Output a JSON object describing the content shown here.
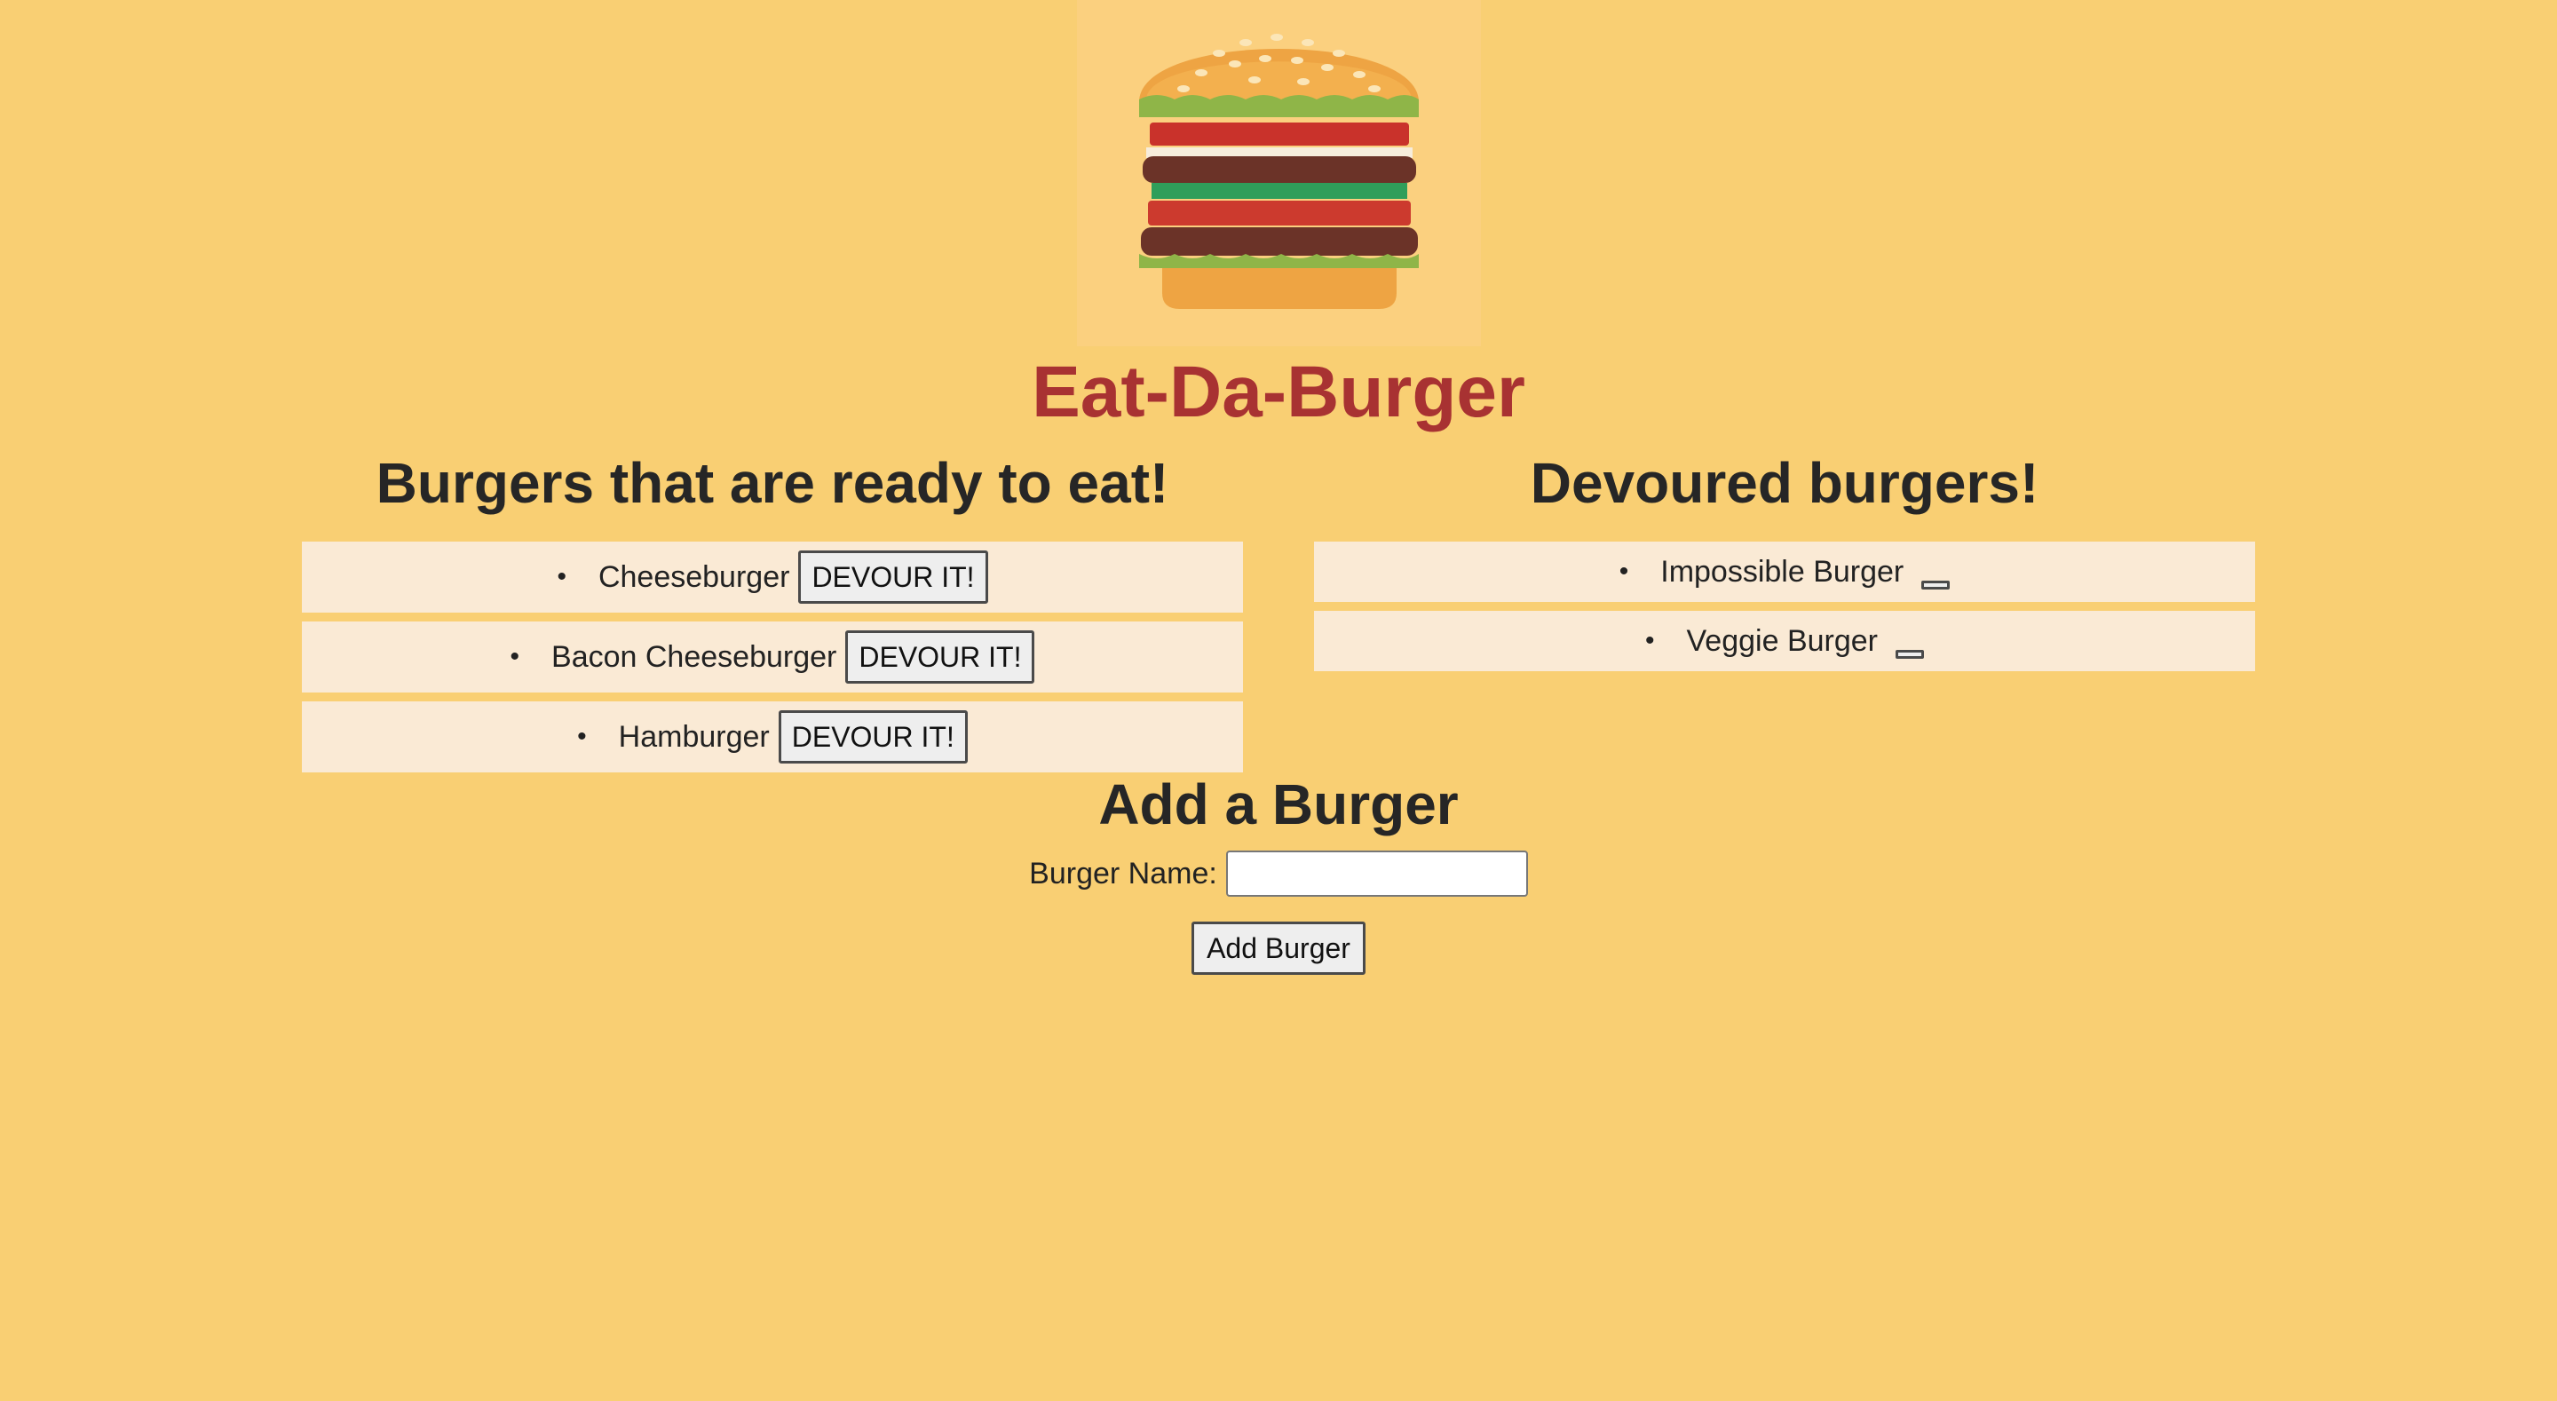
{
  "app": {
    "title": "Eat-Da-Burger",
    "logo_icon": "burger-logo-icon"
  },
  "ready": {
    "heading": "Burgers that are ready to eat!",
    "items": [
      {
        "name": "Cheeseburger",
        "button_label": "DEVOUR IT!"
      },
      {
        "name": "Bacon Cheeseburger",
        "button_label": "DEVOUR IT!"
      },
      {
        "name": "Hamburger",
        "button_label": "DEVOUR IT!"
      }
    ]
  },
  "devoured": {
    "heading": "Devoured burgers!",
    "items": [
      {
        "name": "Impossible Burger"
      },
      {
        "name": "Veggie Burger"
      }
    ]
  },
  "add_form": {
    "heading": "Add a Burger",
    "label": "Burger Name:",
    "input_value": "",
    "submit_label": "Add Burger"
  },
  "colors": {
    "background": "#f9cf73",
    "title": "#a83232",
    "list_item_bg": "#faead5"
  }
}
